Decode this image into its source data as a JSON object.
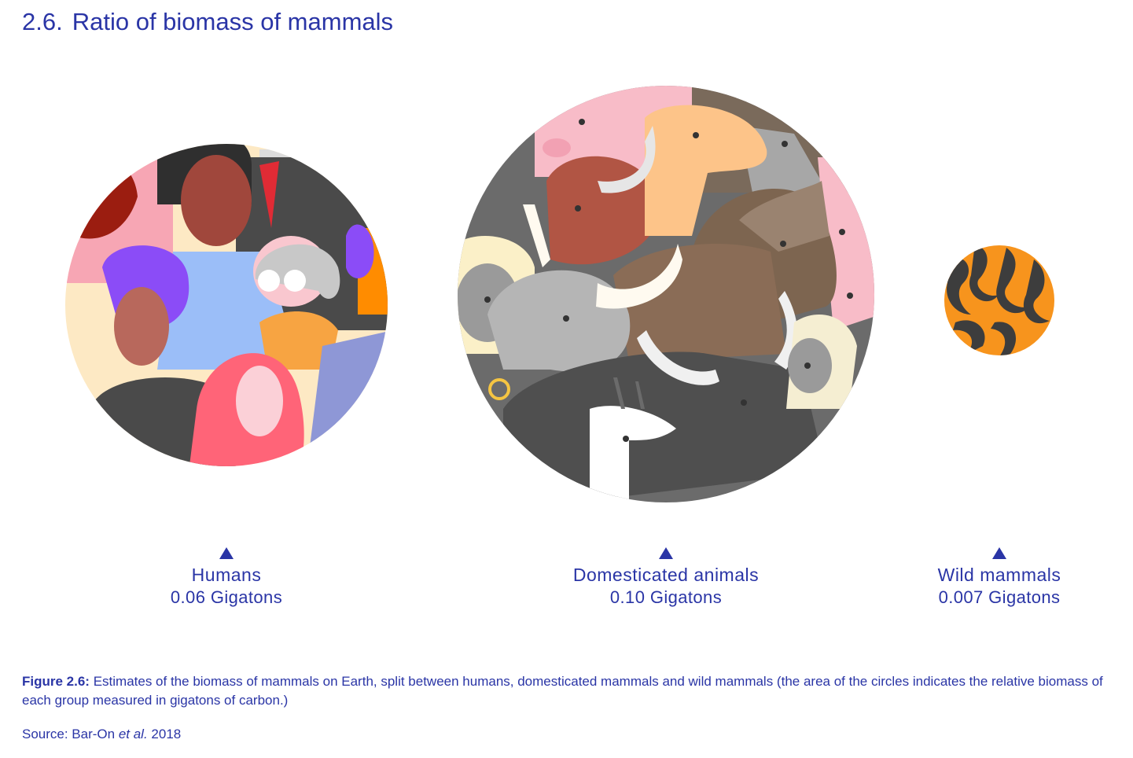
{
  "title": {
    "number": "2.6.",
    "text": "Ratio of biomass of mammals"
  },
  "chart_data": {
    "type": "bubble",
    "unit": "Gigatons",
    "encoding": "circle area proportional to value",
    "categories": [
      "Humans",
      "Domesticated animals",
      "Wild mammals"
    ],
    "values": [
      0.06,
      0.1,
      0.007
    ],
    "value_labels": [
      "0.06 Gigatons",
      "0.10 Gigatons",
      "0.007 Gigatons"
    ],
    "fills": [
      "people illustration",
      "farm animals illustration",
      "tiger stripe pattern"
    ]
  },
  "caption": {
    "label": "Figure 2.6:",
    "text": "Estimates of the biomass of mammals on Earth, split between humans, domesticated mammals and wild mammals (the area of the circles indicates the relative biomass of each group measured in gigatons of carbon.)"
  },
  "source": {
    "prefix": "Source: Bar-On ",
    "italic": "et al.",
    "suffix": " 2018"
  },
  "colors": {
    "text": "#2a35a6",
    "tiger_orange": "#f7941d",
    "tiger_stripe": "#3d3d3d"
  }
}
